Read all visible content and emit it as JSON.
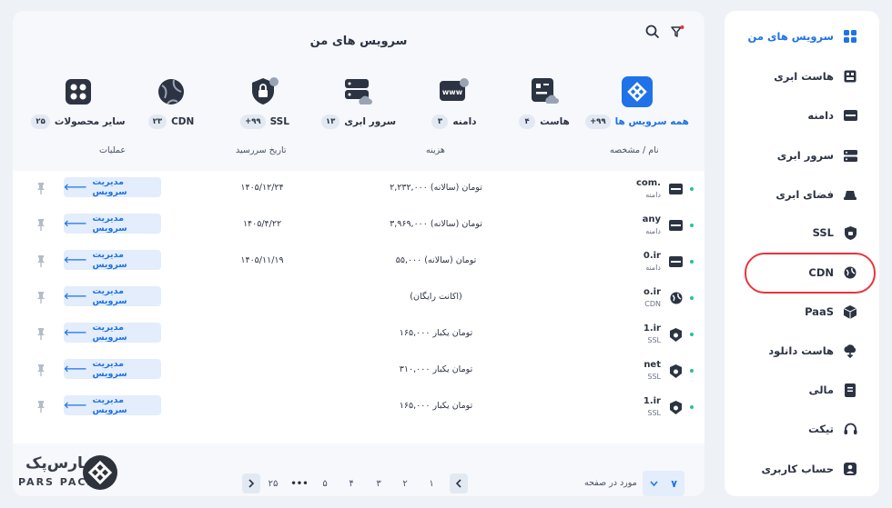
{
  "sidebar": {
    "items": [
      {
        "label": "سرویس های من",
        "icon": "grid-icon",
        "active": true
      },
      {
        "label": "هاست ابری",
        "icon": "cloud-host-icon"
      },
      {
        "label": "دامنه",
        "icon": "domain-icon"
      },
      {
        "label": "سرور ابری",
        "icon": "server-icon"
      },
      {
        "label": "فضای ابری",
        "icon": "cloud-storage-icon"
      },
      {
        "label": "SSL",
        "icon": "lock-icon"
      },
      {
        "label": "CDN",
        "icon": "globe-icon"
      },
      {
        "label": "PaaS",
        "icon": "cube-icon"
      },
      {
        "label": "هاست دانلود",
        "icon": "cloud-download-icon"
      },
      {
        "label": "مالی",
        "icon": "invoice-icon"
      },
      {
        "label": "تیکت",
        "icon": "headset-icon"
      },
      {
        "label": "حساب کاربری",
        "icon": "user-icon"
      }
    ]
  },
  "main": {
    "title": "سرویس های من",
    "categories": [
      {
        "label": "همه سرویس ها",
        "count": "+۹۹",
        "icon": "all-services-icon",
        "active": true
      },
      {
        "label": "هاست",
        "count": "۴",
        "icon": "host-icon"
      },
      {
        "label": "دامنه",
        "count": "۳",
        "icon": "www-icon"
      },
      {
        "label": "سرور ابری",
        "count": "۱۳",
        "icon": "cloud-server-icon"
      },
      {
        "label": "SSL",
        "count": "+۹۹",
        "icon": "ssl-icon"
      },
      {
        "label": "CDN",
        "count": "۲۳",
        "icon": "cdn-icon"
      },
      {
        "label": "سایر محصولات",
        "count": "۲۵",
        "icon": "other-products-icon"
      }
    ],
    "columns": {
      "name": "نام / مشخصه",
      "cost": "هزینه",
      "due": "تاریخ سررسید",
      "actions": "عملیات"
    },
    "manage_label": "مدیریت سرویس",
    "rows": [
      {
        "name": "com.",
        "sub": "دامنه",
        "icon": "domain-icon",
        "cost": "۲,۲۳۲,۰۰۰ تومان (سالانه)",
        "due": "۱۴۰۵/۱۲/۲۴"
      },
      {
        "name": "any",
        "sub": "دامنه",
        "icon": "domain-icon",
        "cost": "۳,۹۶۹,۰۰۰ تومان (سالانه)",
        "due": "۱۴۰۵/۴/۲۲"
      },
      {
        "name": "0.ir",
        "sub": "دامنه",
        "icon": "domain-icon",
        "cost": "۵۵,۰۰۰ تومان (سالانه)",
        "due": "۱۴۰۵/۱۱/۱۹"
      },
      {
        "name": "o.ir",
        "sub": "CDN",
        "icon": "globe-icon",
        "cost": "(اکانت رایگان)",
        "due": ""
      },
      {
        "name": "1.ir",
        "sub": "SSL",
        "icon": "ssl-shield-icon",
        "cost": "۱۶۵,۰۰۰ تومان یکبار",
        "due": ""
      },
      {
        "name": "net",
        "sub": "SSL",
        "icon": "ssl-shield-icon",
        "cost": "۳۱۰,۰۰۰ تومان یکبار",
        "due": ""
      },
      {
        "name": "1.ir",
        "sub": "SSL",
        "icon": "ssl-shield-icon",
        "cost": "۱۶۵,۰۰۰ تومان یکبار",
        "due": ""
      }
    ],
    "pagination": {
      "pages": [
        "۱",
        "۲",
        "۳",
        "۴",
        "۵",
        "•••",
        "۲۵"
      ],
      "per_page_label": "مورد در صفحه",
      "per_page_value": "۷"
    }
  },
  "logo": {
    "fa": "پارس‌پک",
    "en": "PARS PACK"
  },
  "colors": {
    "accent": "#1f72e8",
    "highlight": "#e8353b",
    "status": "#27c29a"
  }
}
